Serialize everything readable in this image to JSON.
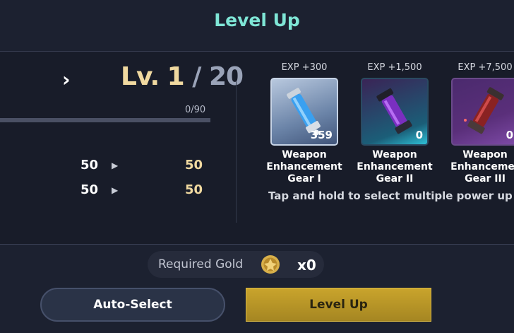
{
  "title": "Level Up",
  "level": {
    "current": "Lv. 1",
    "separator": " / ",
    "max": "20"
  },
  "exp": {
    "text": "0/90",
    "progress": 0.0
  },
  "stats": [
    {
      "old": "50",
      "new": "50"
    },
    {
      "old": "50",
      "new": "50"
    }
  ],
  "items": [
    {
      "exp": "EXP +300",
      "name_lines": [
        "Weapon",
        "Enhancement",
        "Gear I"
      ],
      "count": "359",
      "icon": "blue-canister-icon"
    },
    {
      "exp": "EXP +1,500",
      "name_lines": [
        "Weapon",
        "Enhancement",
        "Gear II"
      ],
      "count": "0",
      "icon": "purple-canister-icon"
    },
    {
      "exp": "EXP +7,500",
      "name_lines": [
        "Weapon",
        "Enhancemer",
        "Gear III"
      ],
      "count": "0",
      "icon": "red-canister-icon"
    }
  ],
  "hint": "Tap and hold to select multiple power up ite",
  "gold": {
    "label": "Required Gold",
    "amount": "x0",
    "icon": "gold-coin-icon"
  },
  "buttons": {
    "auto_select": "Auto-Select",
    "level_up": "Level Up"
  }
}
